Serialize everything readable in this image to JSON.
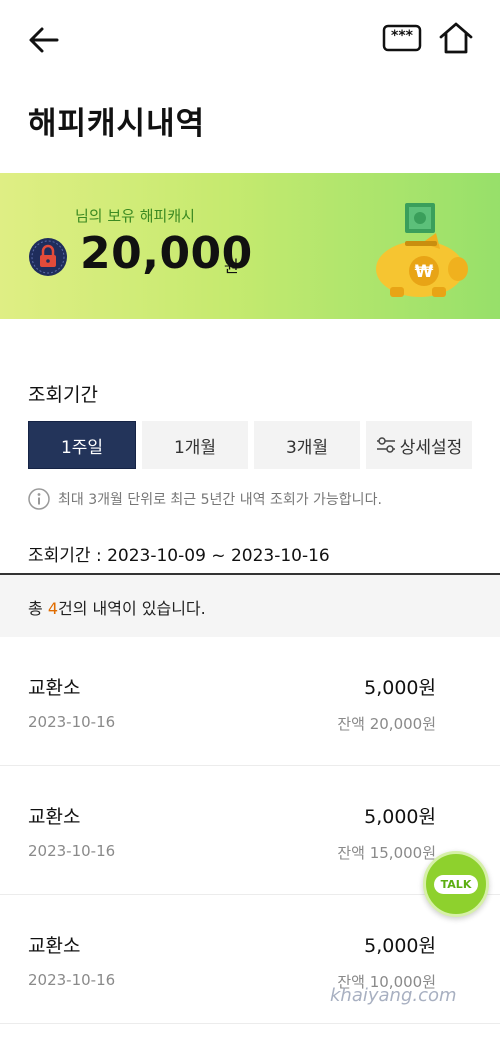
{
  "header": {
    "title": "해피캐시내역",
    "pin_label": "***"
  },
  "balance": {
    "owner_label": "님의 보유 해피캐시",
    "amount": "20,000",
    "unit": "원"
  },
  "period": {
    "label": "조회기간",
    "tabs": [
      {
        "label": "1주일",
        "active": true
      },
      {
        "label": "1개월",
        "active": false
      },
      {
        "label": "3개월",
        "active": false
      },
      {
        "label": "상세설정",
        "active": false
      }
    ],
    "notice": "최대 3개월 단위로 최근 5년간 내역 조회가 가능합니다.",
    "range": "조회기간 : 2023-10-09 ~ 2023-10-16"
  },
  "summary": {
    "prefix": "총 ",
    "count": "4",
    "suffix": "건의 내역이 있습니다."
  },
  "transactions": [
    {
      "title": "교환소",
      "amount": "5,000원",
      "date": "2023-10-16",
      "remaining": "잔액 20,000원"
    },
    {
      "title": "교환소",
      "amount": "5,000원",
      "date": "2023-10-16",
      "remaining": "잔액 15,000원"
    },
    {
      "title": "교환소",
      "amount": "5,000원",
      "date": "2023-10-16",
      "remaining": "잔액 10,000원"
    }
  ],
  "talk_button": {
    "label": "TALK"
  },
  "watermark": "khaiyang.com",
  "colors": {
    "accent_tab": "#23345a",
    "highlight": "#e06c00",
    "banner_start": "#dfee84",
    "banner_end": "#97e06a",
    "talk": "#8ed12d"
  }
}
